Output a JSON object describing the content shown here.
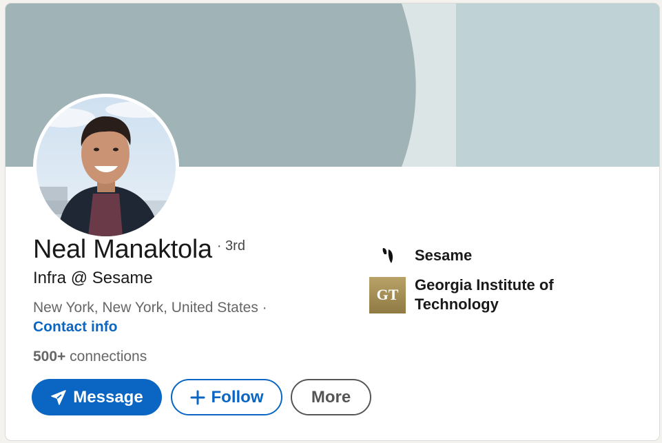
{
  "profile": {
    "name": "Neal Manaktola",
    "degree": "· 3rd",
    "headline": "Infra @ Sesame",
    "location": "New York, New York, United States ·",
    "contact_info": "Contact info",
    "connections_count": "500+",
    "connections_label": "connections"
  },
  "actions": {
    "message": "Message",
    "follow": "Follow",
    "more": "More"
  },
  "organizations": [
    {
      "name": "Sesame",
      "logo": "sesame-logo"
    },
    {
      "name": "Georgia Institute of Technology",
      "logo": "georgia-tech-logo",
      "logo_text": "GT"
    }
  ],
  "icons": {
    "message": "send-icon",
    "follow": "plus-icon"
  },
  "colors": {
    "accent": "#0a66c2",
    "banner_dark": "#a0b3b6",
    "banner_light": "#bfd3d6",
    "banner_mid": "#dbe5e6",
    "gt_gold": "#a58f55"
  }
}
